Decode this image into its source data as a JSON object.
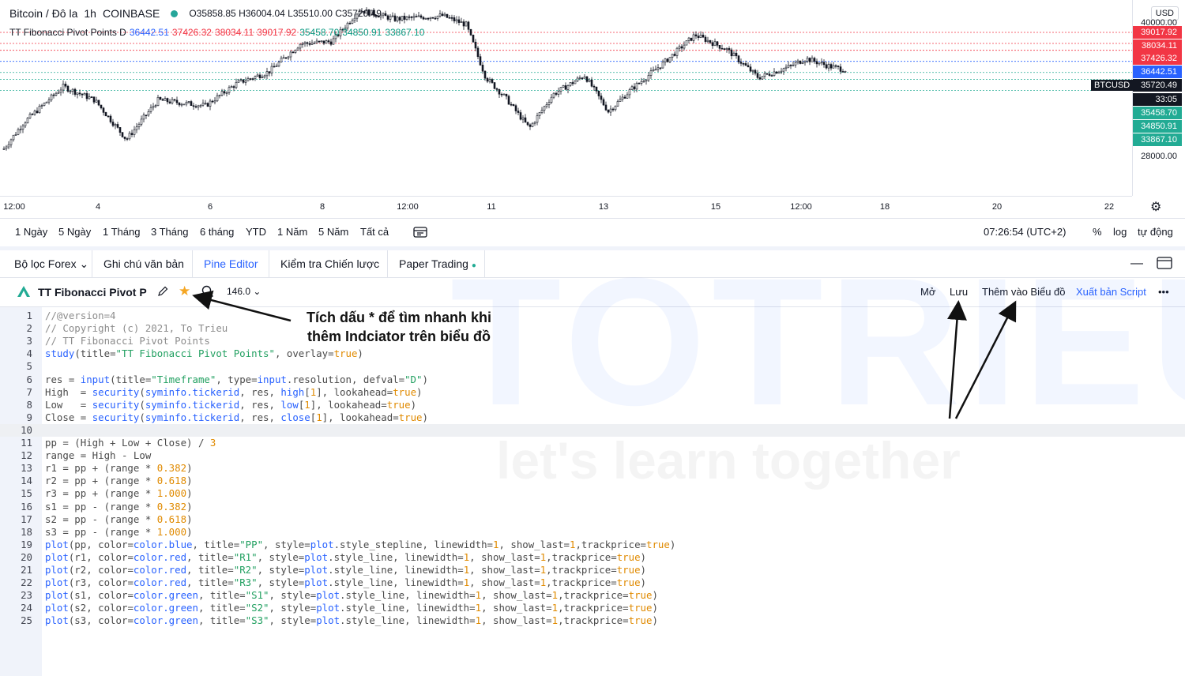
{
  "chart": {
    "symbol": "Bitcoin / Đô la",
    "interval": "1h",
    "exchange": "COINBASE",
    "ohlc": {
      "o_label": "O",
      "o": "35858.85",
      "h_label": "H",
      "h": "36004.04",
      "l_label": "L",
      "l": "35510.00",
      "c_label": "C",
      "c": "35720.49"
    },
    "indicator": {
      "name": "TT Fibonacci Pivot Points D",
      "pp": "36442.51",
      "r1": "37426.32",
      "r2": "38034.11",
      "r3": "39017.92",
      "s1": "35458.70",
      "s2": "34850.91",
      "s3": "33867.10"
    },
    "currency_button": "USD",
    "ticker_tag": "BTCUSD",
    "countdown": "33:05",
    "price_labels": [
      {
        "text": "40000.00",
        "kind": "axis"
      },
      {
        "text": "39017.92",
        "kind": "red"
      },
      {
        "text": "38034.11",
        "kind": "red"
      },
      {
        "text": "37426.32",
        "kind": "red"
      },
      {
        "text": "36442.51",
        "kind": "blue"
      },
      {
        "text": "35720.49",
        "kind": "dark"
      },
      {
        "text": "33:05",
        "kind": "dark"
      },
      {
        "text": "35458.70",
        "kind": "green"
      },
      {
        "text": "34850.91",
        "kind": "green"
      },
      {
        "text": "33867.10",
        "kind": "green"
      },
      {
        "text": "28000.00",
        "kind": "axis"
      }
    ],
    "time_labels": [
      "12:00",
      "4",
      "6",
      "8",
      "12:00",
      "11",
      "13",
      "15",
      "12:00",
      "18",
      "20",
      "22"
    ],
    "colors": {
      "up": "#131722",
      "down": "#131722",
      "red": "#f23645",
      "green": "#22ab94",
      "blue": "#2962ff"
    }
  },
  "range_bar": {
    "buttons": [
      "1 Ngày",
      "5 Ngày",
      "1 Tháng",
      "3 Tháng",
      "6 tháng",
      "YTD",
      "1 Năm",
      "5 Năm",
      "Tất cả"
    ],
    "time": "07:26:54 (UTC+2)",
    "percent": "%",
    "log": "log",
    "auto": "tự động"
  },
  "tabs": [
    "Bộ lọc Forex",
    "Ghi chú văn bản",
    "Pine Editor",
    "Kiểm tra Chiến lược",
    "Paper Trading"
  ],
  "editor_toolbar": {
    "script_name": "TT Fibonacci Pivot P",
    "version": "146.0",
    "open": "Mở",
    "save": "Lưu",
    "add_to_chart": "Thêm vào Biểu đồ",
    "publish": "Xuất bản Script",
    "more": "•••"
  },
  "annotation": {
    "line1": "Tích dấu * để tìm nhanh khi",
    "line2": "thêm Indciator trên biểu đồ"
  },
  "watermark": {
    "brand": "TOTRIEU",
    "tagline": "let's learn together"
  },
  "code_lines": [
    "//@version=4",
    "// Copyright (c) 2021, To Trieu",
    "// TT Fibonacci Pivot Points",
    "study(title=\"TT Fibonacci Pivot Points\", overlay=true)",
    "",
    "res = input(title=\"Timeframe\", type=input.resolution, defval=\"D\")",
    "High  = security(syminfo.tickerid, res, high[1], lookahead=true)",
    "Low   = security(syminfo.tickerid, res, low[1], lookahead=true)",
    "Close = security(syminfo.tickerid, res, close[1], lookahead=true)",
    "",
    "pp = (High + Low + Close) / 3",
    "range = High - Low",
    "r1 = pp + (range * 0.382)",
    "r2 = pp + (range * 0.618)",
    "r3 = pp + (range * 1.000)",
    "s1 = pp - (range * 0.382)",
    "s2 = pp - (range * 0.618)",
    "s3 = pp - (range * 1.000)",
    "plot(pp, color=color.blue, title=\"PP\", style=plot.style_stepline, linewidth=1, show_last=1,trackprice=true)",
    "plot(r1, color=color.red, title=\"R1\", style=plot.style_line, linewidth=1, show_last=1,trackprice=true)",
    "plot(r2, color=color.red, title=\"R2\", style=plot.style_line, linewidth=1, show_last=1,trackprice=true)",
    "plot(r3, color=color.red, title=\"R3\", style=plot.style_line, linewidth=1, show_last=1,trackprice=true)",
    "plot(s1, color=color.green, title=\"S1\", style=plot.style_line, linewidth=1, show_last=1,trackprice=true)",
    "plot(s2, color=color.green, title=\"S2\", style=plot.style_line, linewidth=1, show_last=1,trackprice=true)",
    "plot(s3, color=color.green, title=\"S3\", style=plot.style_line, linewidth=1, show_last=1,trackprice=true)"
  ],
  "highlighted_line": 10
}
